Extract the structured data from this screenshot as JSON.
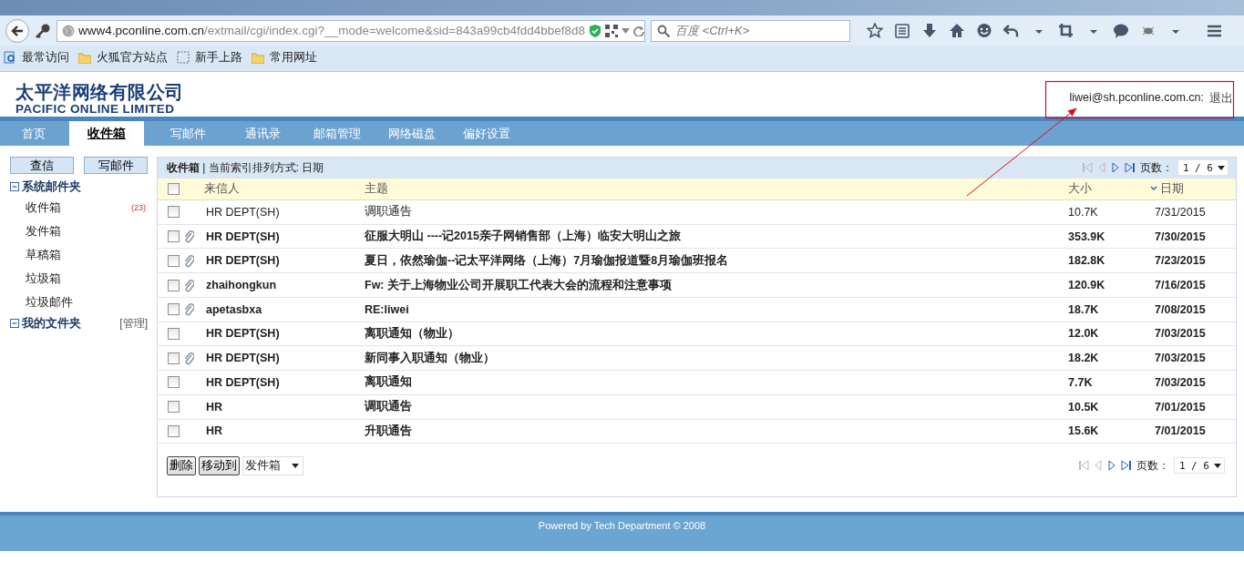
{
  "browser": {
    "url_host": "www4.pconline.com.cn",
    "url_path": "/extmail/cgi/index.cgi?__mode=welcome&sid=843a99cb4fdd4bbef8d8",
    "search_placeholder": "百度 <Ctrl+K>",
    "bookmarks": [
      {
        "label": "最常访问",
        "kind": "smart"
      },
      {
        "label": "火狐官方站点",
        "kind": "folder"
      },
      {
        "label": "新手上路",
        "kind": "dashed"
      },
      {
        "label": "常用网址",
        "kind": "folder"
      }
    ]
  },
  "header": {
    "logo_cn": "太平洋网络有限公司",
    "logo_en": "PACIFIC ONLINE LIMITED",
    "user_email": "liwei@sh.pconline.com.cn:",
    "logout": "退出"
  },
  "nav": [
    {
      "label": "首页",
      "selected": false
    },
    {
      "label": "收件箱",
      "selected": true
    },
    {
      "label": "写邮件",
      "selected": false
    },
    {
      "label": "通讯录",
      "selected": false
    },
    {
      "label": "邮箱管理",
      "selected": false
    },
    {
      "label": "网络磁盘",
      "selected": false
    },
    {
      "label": "偏好设置",
      "selected": false
    }
  ],
  "sidebar": {
    "buttons": [
      "查信",
      "写邮件"
    ],
    "groups": [
      {
        "title": "系统邮件夹",
        "expanded": true,
        "items": [
          {
            "label": "收件箱",
            "count": "(23)"
          },
          {
            "label": "发件箱"
          },
          {
            "label": "草稿箱"
          },
          {
            "label": "垃圾箱"
          },
          {
            "label": "垃圾邮件"
          }
        ]
      },
      {
        "title": "我的文件夹",
        "expanded": true,
        "manage": "[管理]"
      }
    ]
  },
  "list": {
    "title": "**收件箱** | 当前索引排列方式: 日期",
    "pager_top": {
      "label": "页数：",
      "page": "1 / 6"
    },
    "select_all": {
      "checked": false
    },
    "columns": [
      {
        "label": "来信人",
        "sorted": false
      },
      {
        "label": "主题",
        "sorted": false
      },
      {
        "label": "大小",
        "sorted": false
      },
      {
        "label": "日期",
        "sorted": true
      }
    ],
    "rows": [
      {
        "checked": false,
        "unread": false,
        "attachment": false,
        "sender": "HR DEPT(SH)",
        "subject": "调职通告",
        "size": "10.7K",
        "date": "7/31/2015"
      },
      {
        "checked": false,
        "unread": true,
        "attachment": true,
        "sender": "HR DEPT(SH)",
        "subject": "征服大明山 ----记2015亲子网销售部（上海）临安大明山之旅",
        "size": "353.9K",
        "date": "7/30/2015"
      },
      {
        "checked": false,
        "unread": true,
        "attachment": true,
        "sender": "HR DEPT(SH)",
        "subject": "夏日，依然瑜伽--记太平洋网络（上海）7月瑜伽报道暨8月瑜伽班报名",
        "size": "182.8K",
        "date": "7/23/2015"
      },
      {
        "checked": false,
        "unread": true,
        "attachment": true,
        "sender": "zhaihongkun",
        "subject": "Fw: 关于上海物业公司开展职工代表大会的流程和注意事项",
        "size": "120.9K",
        "date": "7/16/2015"
      },
      {
        "checked": false,
        "unread": true,
        "attachment": true,
        "sender": "apetasbxa",
        "subject": "RE:liwei",
        "size": "18.7K",
        "date": "7/08/2015"
      },
      {
        "checked": false,
        "unread": true,
        "attachment": false,
        "sender": "HR DEPT(SH)",
        "subject": "离职通知（物业）",
        "size": "12.0K",
        "date": "7/03/2015"
      },
      {
        "checked": false,
        "unread": true,
        "attachment": true,
        "sender": "HR DEPT(SH)",
        "subject": "新同事入职通知（物业）",
        "size": "18.2K",
        "date": "7/03/2015"
      },
      {
        "checked": false,
        "unread": true,
        "attachment": false,
        "sender": "HR DEPT(SH)",
        "subject": "离职通知",
        "size": "7.7K",
        "date": "7/03/2015"
      },
      {
        "checked": false,
        "unread": true,
        "attachment": false,
        "sender": "HR",
        "subject": "调职通告",
        "size": "10.5K",
        "date": "7/01/2015"
      },
      {
        "checked": false,
        "unread": true,
        "attachment": false,
        "sender": "HR",
        "subject": "升职通告",
        "size": "15.6K",
        "date": "7/01/2015"
      }
    ],
    "actions": [
      "删除",
      "移动到"
    ],
    "move_target": "发件箱",
    "pager_bottom": {
      "label": "页数：",
      "page": "1 / 6"
    }
  },
  "footer": "Powered by Tech Department © 2008"
}
